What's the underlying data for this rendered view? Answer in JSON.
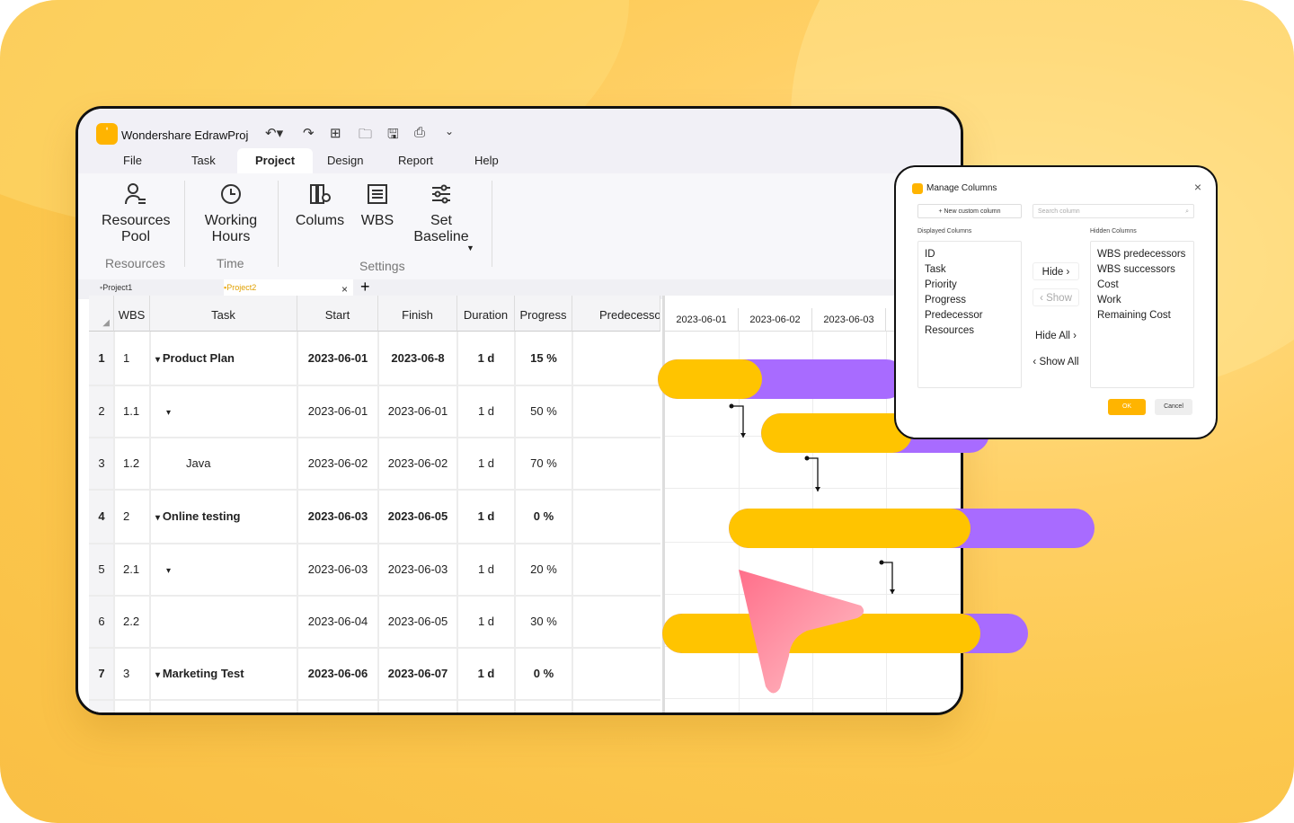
{
  "app": {
    "title": "Wondershare EdrawProj",
    "menu": [
      "File",
      "Task",
      "Project",
      "Design",
      "Report",
      "Help"
    ],
    "active_menu": "Project"
  },
  "ribbon": {
    "resources_pool": "Resources\nPool",
    "working_hours": "Working\nHours",
    "columns": "Colums",
    "wbs": "WBS",
    "set_baseline": "Set\nBaseline",
    "group_resources": "Resources",
    "group_time": "Time",
    "group_settings": "Settings"
  },
  "doc_tabs": [
    "Project1",
    "Project2"
  ],
  "grid": {
    "headers": [
      "WBS",
      "Task",
      "Start",
      "Finish",
      "Duration",
      "Progress",
      "Predecesso"
    ],
    "rows": [
      {
        "num": "1",
        "wbs": "1",
        "task": "Product Plan",
        "start": "2023-06-01",
        "finish": "2023-06-8",
        "duration": "1 d",
        "progress": "15 %",
        "summary": true
      },
      {
        "num": "2",
        "wbs": "1.1",
        "task": "",
        "start": "2023-06-01",
        "finish": "2023-06-01",
        "duration": "1 d",
        "progress": "50 %",
        "summary": false
      },
      {
        "num": "3",
        "wbs": "1.2",
        "task": "Java",
        "start": "2023-06-02",
        "finish": "2023-06-02",
        "duration": "1 d",
        "progress": "70 %",
        "summary": false
      },
      {
        "num": "4",
        "wbs": "2",
        "task": "Online testing",
        "start": "2023-06-03",
        "finish": "2023-06-05",
        "duration": "1 d",
        "progress": "0 %",
        "summary": true
      },
      {
        "num": "5",
        "wbs": "2.1",
        "task": "",
        "start": "2023-06-03",
        "finish": "2023-06-03",
        "duration": "1 d",
        "progress": "20 %",
        "summary": false
      },
      {
        "num": "6",
        "wbs": "2.2",
        "task": "",
        "start": "2023-06-04",
        "finish": "2023-06-05",
        "duration": "1 d",
        "progress": "30 %",
        "summary": false
      },
      {
        "num": "7",
        "wbs": "3",
        "task": "Marketing Test",
        "start": "2023-06-06",
        "finish": "2023-06-07",
        "duration": "1 d",
        "progress": "0 %",
        "summary": true
      }
    ]
  },
  "gantt": {
    "dates": [
      "2023-06-01",
      "2023-06-02",
      "2023-06-03"
    ],
    "colors": {
      "progress": "#ffc400",
      "remaining": "#a86bff"
    }
  },
  "dialog": {
    "title": "Manage Columns",
    "new_column": "+ New custom column",
    "search_placeholder": "Search column",
    "displayed_label": "Displayed Columns",
    "hidden_label": "Hidden Columns",
    "displayed": [
      "ID",
      "Task",
      "Priority",
      "Progress",
      "Predecessor",
      "Resources"
    ],
    "hidden": [
      "WBS predecessors",
      "WBS successors",
      "Cost",
      "Work",
      "Remaining Cost"
    ],
    "hide": "Hide ›",
    "show": "‹ Show",
    "hide_all": "Hide All ›",
    "show_all": "‹ Show All",
    "ok": "OK",
    "cancel": "Cancel"
  }
}
